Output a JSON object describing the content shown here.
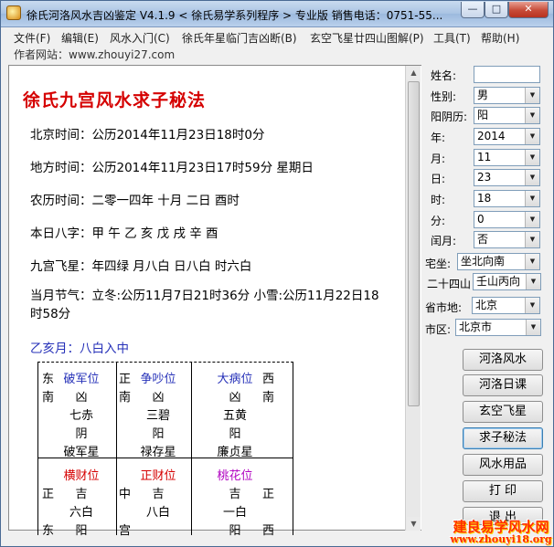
{
  "window": {
    "title": "徐氏河洛风水吉凶鉴定 V4.1.9  < 徐氏易学系列程序 > 专业版   销售电话：0751-55...",
    "min": "—",
    "max": "□",
    "close": "✕"
  },
  "menu": [
    "文件(F)",
    "编辑(E)",
    "风水入门(C)",
    "徐氏年星临门吉凶断(B)",
    "玄空飞星廿四山图解(P)",
    "工具(T)",
    "帮助(H)"
  ],
  "author": "作者网站：www.zhouyi27.com",
  "doc": {
    "title": "徐氏九宫风水求子秘法",
    "beijing_time": "北京时间：公历2014年11月23日18时0分",
    "local_time": "地方时间：公历2014年11月23日17时59分   星期日",
    "lunar_time": "农历时间：二零一四年 十月 二日 酉时",
    "bazi": "本日八字：甲 午     乙 亥     戊 戌     辛 酉",
    "nine_palace": "九宫飞星：年四绿   月八白   日八白   时六白",
    "solar_term": "当月节气：立冬:公历11月7日21时36分 小雪:公历11月22日18时58分",
    "month_star": "乙亥月：八白入中"
  },
  "grid": {
    "cells": [
      {
        "dir_l": "东",
        "pos": "破军位",
        "dir_r": "",
        "row2_l": "南",
        "row2_c": "凶",
        "row2_r": "",
        "star": "七赤",
        "yin": "阴",
        "name": "破军星",
        "color": "blue"
      },
      {
        "dir_l": "正",
        "pos": "争吵位",
        "dir_r": "",
        "row2_l": "南",
        "row2_c": "凶",
        "row2_r": "",
        "star": "三碧",
        "yin": "阳",
        "name": "禄存星",
        "color": "blue"
      },
      {
        "dir_l": "",
        "pos": "大病位",
        "dir_r": "西",
        "row2_l": "",
        "row2_c": "凶",
        "row2_r": "南",
        "star": "五黄",
        "yin": "阳",
        "name": "廉贞星",
        "color": "blue"
      },
      {
        "dir_l": "",
        "pos": "横财位",
        "dir_r": "",
        "row2_l": "正",
        "row2_c": "吉",
        "row2_r": "",
        "star": "六白",
        "yin": "阳",
        "name": "",
        "color": "red",
        "row4_l": "东"
      },
      {
        "dir_l": "",
        "pos": "正财位",
        "dir_r": "",
        "row2_l": "中",
        "row2_c": "吉",
        "row2_r": "",
        "star": "八白",
        "yin": "",
        "name": "",
        "color": "red",
        "row4_l": "宫"
      },
      {
        "dir_l": "",
        "pos": "桃花位",
        "dir_r": "",
        "row2_l": "",
        "row2_c": "吉",
        "row2_r": "正",
        "star": "一白",
        "yin": "阳",
        "name": "",
        "color": "purple",
        "row4_r": "西"
      }
    ]
  },
  "form": {
    "name_label": "姓名:",
    "name_value": "",
    "gender_label": "性别:",
    "gender_value": "男",
    "calendar_label": "阳阴历:",
    "calendar_value": "阳",
    "year_label": "年:",
    "year_value": "2014",
    "month_label": "月:",
    "month_value": "11",
    "day_label": "日:",
    "day_value": "23",
    "hour_label": "时:",
    "hour_value": "18",
    "minute_label": "分:",
    "minute_value": "0",
    "leap_label": "闰月:",
    "leap_value": "否",
    "house_label": "宅坐:",
    "house_value": "坐北向南",
    "mountain_label": "二十四山",
    "mountain_value": "壬山丙向",
    "province_label": "省市地:",
    "province_value": "北京",
    "city_label": "市区:",
    "city_value": "北京市"
  },
  "buttons": [
    "河洛风水",
    "河洛日课",
    "玄空飞星",
    "求子秘法",
    "风水用品",
    "打 印",
    "退 出"
  ],
  "watermark": {
    "line1": "建良易学风水网",
    "line2": "www.zhouyi18.org"
  }
}
